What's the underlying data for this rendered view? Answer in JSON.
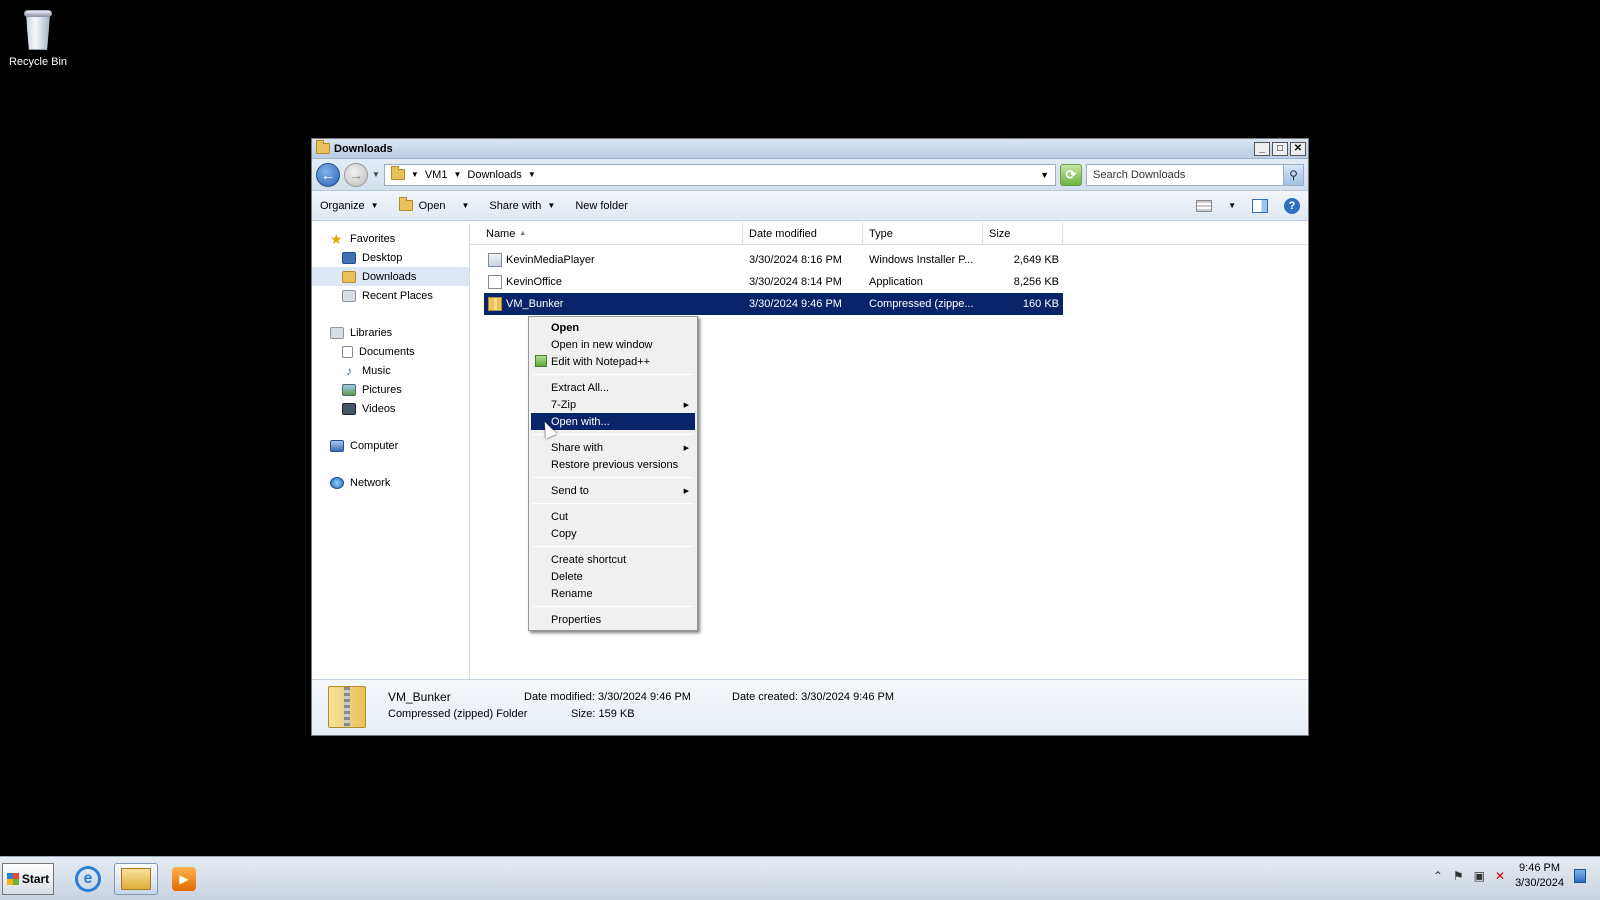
{
  "desktop": {
    "recycle_bin_label": "Recycle Bin"
  },
  "window": {
    "title": "Downloads",
    "buttons": {
      "minimize": "_",
      "maximize": "□",
      "close": "✕"
    }
  },
  "address": {
    "crumbs": [
      "VM1",
      "Downloads"
    ],
    "search_placeholder": "Search Downloads"
  },
  "toolbar": {
    "organize": "Organize",
    "open": "Open",
    "share_with": "Share with",
    "new_folder": "New folder"
  },
  "nav": {
    "favorites": "Favorites",
    "favorites_items": [
      "Desktop",
      "Downloads",
      "Recent Places"
    ],
    "libraries": "Libraries",
    "libraries_items": [
      "Documents",
      "Music",
      "Pictures",
      "Videos"
    ],
    "computer": "Computer",
    "network": "Network"
  },
  "columns": {
    "name": "Name",
    "date": "Date modified",
    "type": "Type",
    "size": "Size"
  },
  "files": [
    {
      "name": "KevinMediaPlayer",
      "date": "3/30/2024 8:16 PM",
      "type": "Windows Installer P...",
      "size": "2,649 KB",
      "icon": "msi-icon"
    },
    {
      "name": "KevinOffice",
      "date": "3/30/2024 8:14 PM",
      "type": "Application",
      "size": "8,256 KB",
      "icon": "application-icon"
    },
    {
      "name": "VM_Bunker",
      "date": "3/30/2024 9:46 PM",
      "type": "Compressed (zippe...",
      "size": "160 KB",
      "icon": "zip-folder-icon"
    }
  ],
  "context_menu": {
    "open": "Open",
    "open_new_window": "Open in new window",
    "edit_notepad": "Edit with Notepad++",
    "extract_all": "Extract All...",
    "seven_zip": "7-Zip",
    "open_with": "Open with...",
    "share_with": "Share with",
    "restore": "Restore previous versions",
    "send_to": "Send to",
    "cut": "Cut",
    "copy": "Copy",
    "create_shortcut": "Create shortcut",
    "delete": "Delete",
    "rename": "Rename",
    "properties": "Properties"
  },
  "details": {
    "name": "VM_Bunker",
    "kind": "Compressed (zipped) Folder",
    "date_modified": "Date modified:  3/30/2024 9:46 PM",
    "size": "Size:  159 KB",
    "date_created": "Date created:  3/30/2024 9:46 PM"
  },
  "taskbar": {
    "start": "Start",
    "time": "9:46 PM",
    "date": "3/30/2024"
  }
}
